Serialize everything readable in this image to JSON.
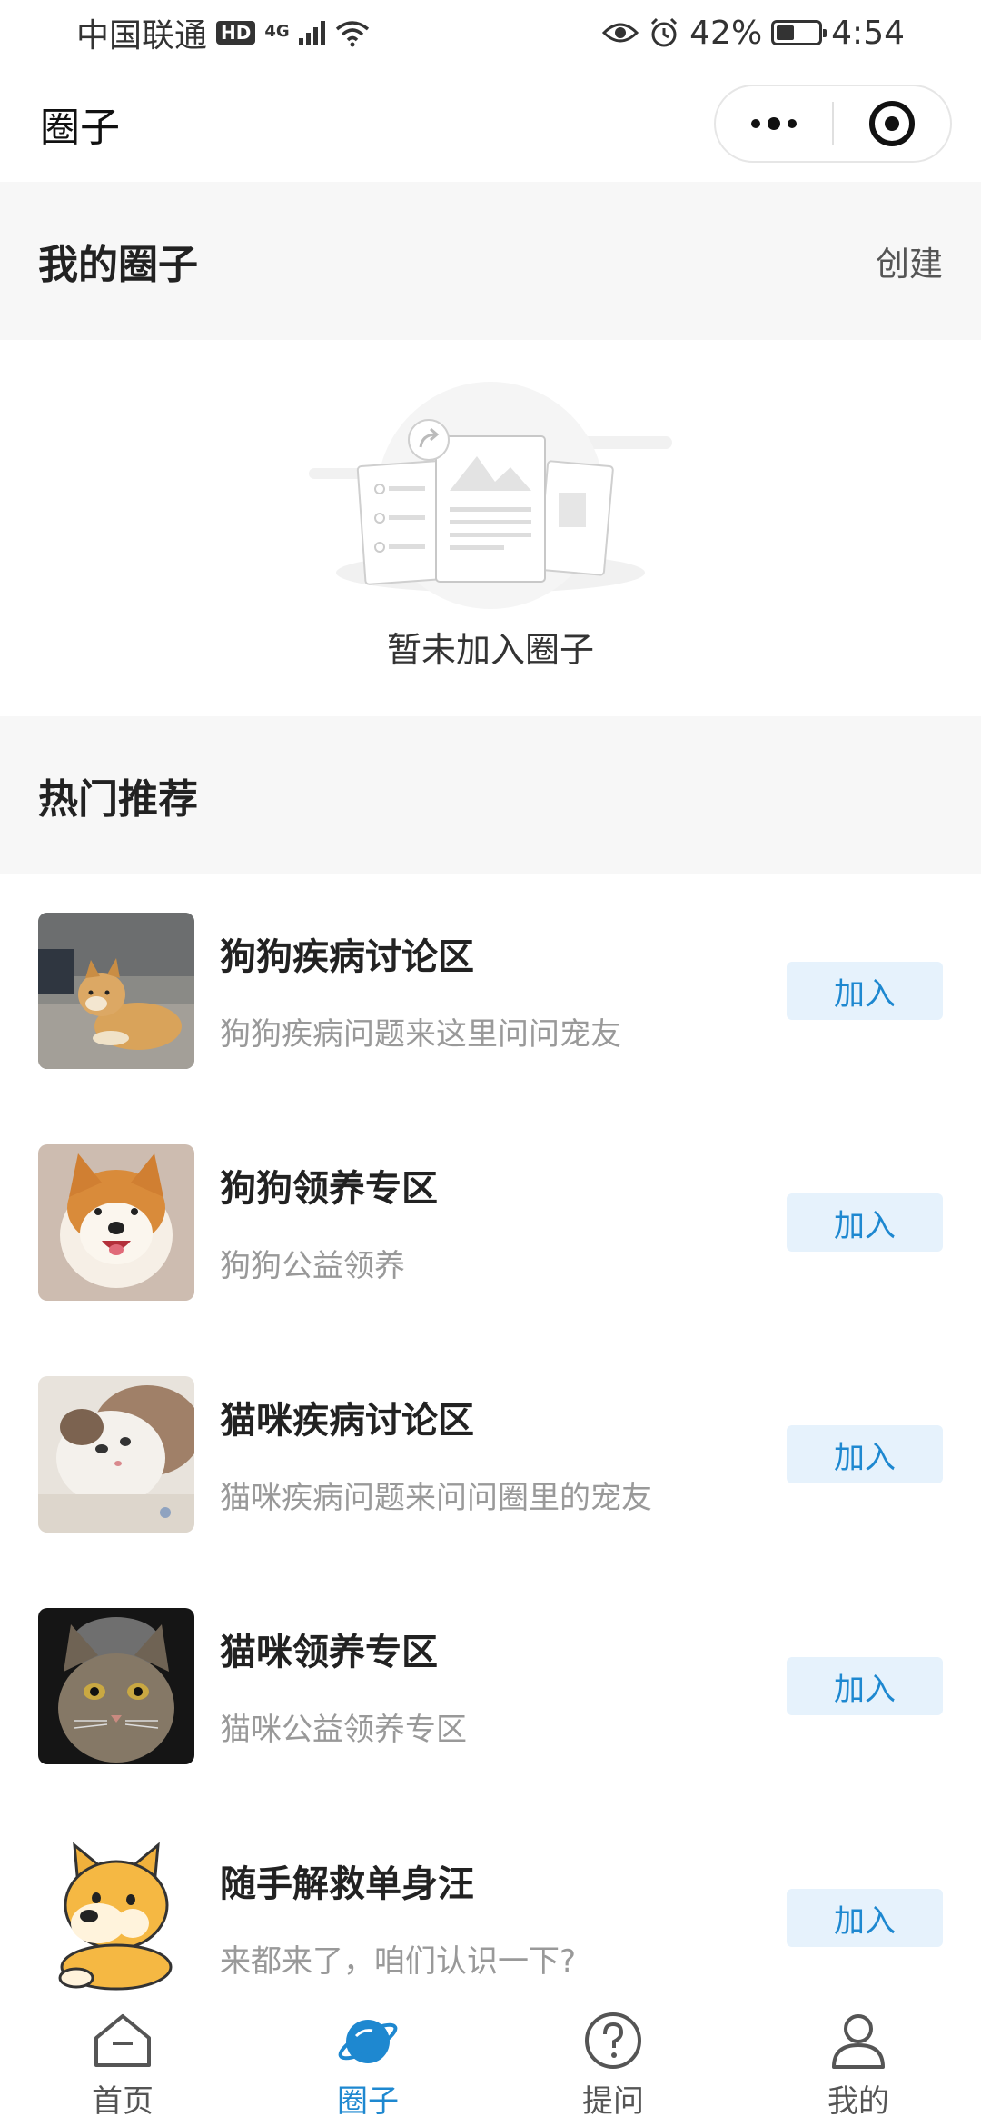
{
  "status_bar": {
    "carrier": "中国联通",
    "hd": "HD",
    "network": "4G",
    "battery": "42%",
    "battery_level": 0.42,
    "time": "4:54"
  },
  "nav": {
    "title": "圈子"
  },
  "my_circles": {
    "title": "我的圈子",
    "create_label": "创建",
    "empty_text": "暂未加入圈子"
  },
  "hot": {
    "title": "热门推荐",
    "join_label": "加入",
    "items": [
      {
        "title": "狗狗疾病讨论区",
        "desc": "狗狗疾病问题来这里问问宠友",
        "image": "shiba-dog-photo"
      },
      {
        "title": "狗狗领养专区",
        "desc": "狗狗公益领养",
        "image": "akita-dog-photo"
      },
      {
        "title": "猫咪疾病讨论区",
        "desc": "猫咪疾病问题来问问圈里的宠友",
        "image": "kitten-photo"
      },
      {
        "title": "猫咪领养专区",
        "desc": "猫咪公益领养专区",
        "image": "tabby-cat-photo"
      },
      {
        "title": "随手解救单身汪",
        "desc": "来都来了，咱们认识一下?",
        "image": "cartoon-doge"
      }
    ]
  },
  "tabs": [
    {
      "label": "首页",
      "icon": "home-icon"
    },
    {
      "label": "圈子",
      "icon": "planet-icon",
      "active": true
    },
    {
      "label": "提问",
      "icon": "question-icon"
    },
    {
      "label": "我的",
      "icon": "person-icon"
    }
  ],
  "colors": {
    "accent": "#1e88d0",
    "join_bg": "#e6f2fc",
    "section_bg": "#f7f7f7"
  }
}
